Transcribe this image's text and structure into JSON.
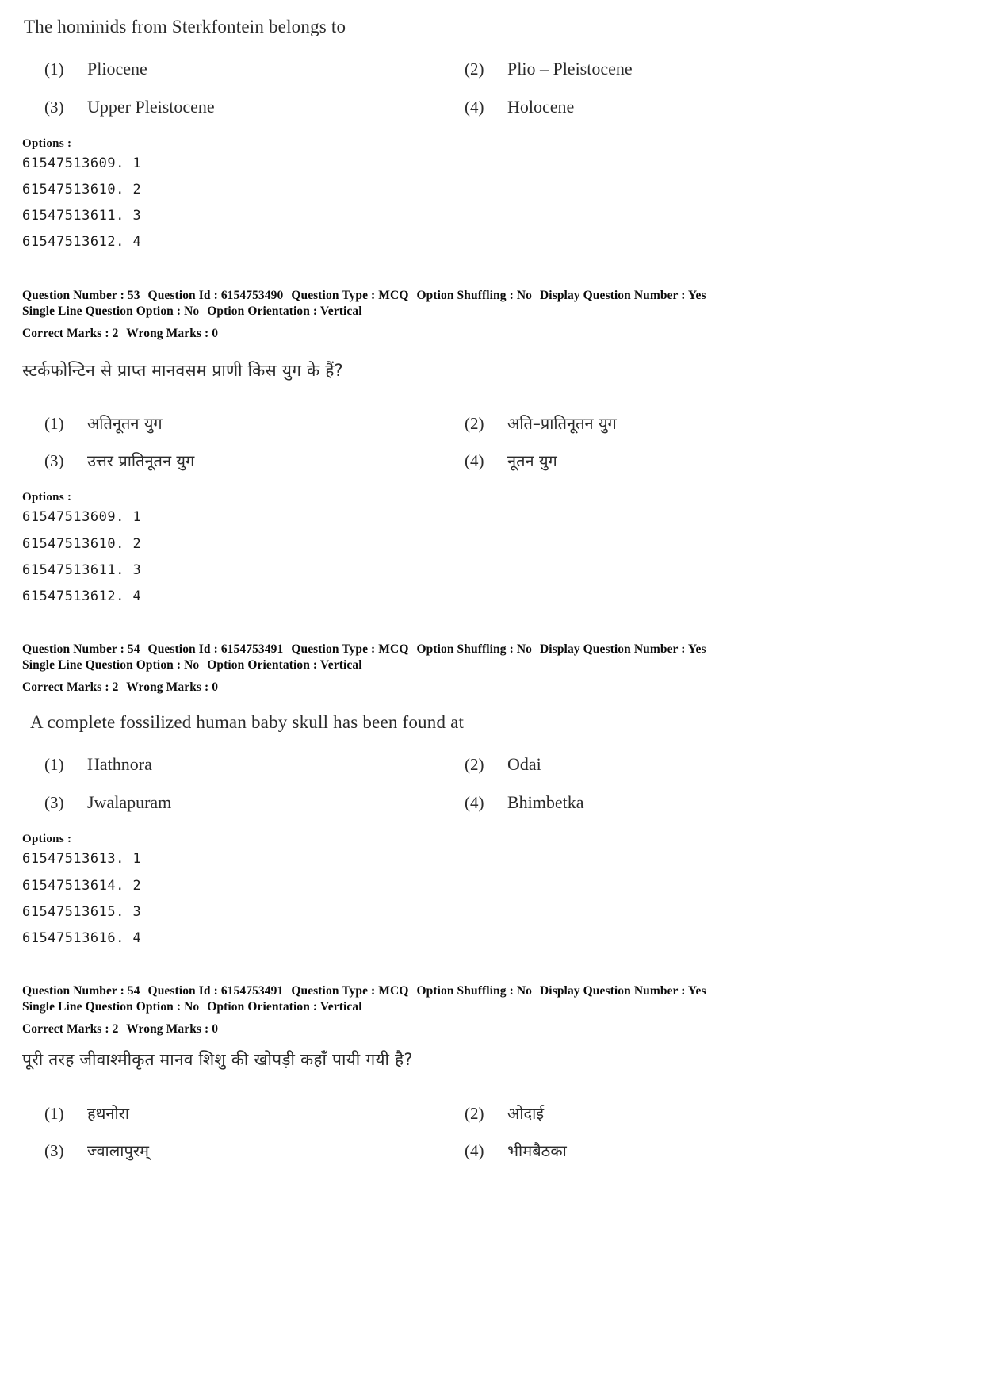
{
  "labels": {
    "options_heading": "Options :",
    "question_number": "Question Number :",
    "question_id": "Question Id :",
    "question_type": "Question Type :",
    "option_shuffling": "Option Shuffling :",
    "display_question_number": "Display Question Number :",
    "single_line_question_option": "Single Line Question Option :",
    "option_orientation": "Option Orientation :",
    "correct_marks": "Correct Marks :",
    "wrong_marks": "Wrong Marks :"
  },
  "blocks": [
    {
      "id": "q53-english",
      "stem": "The hominids from Sterkfontein belongs to",
      "choices": [
        {
          "num": "(1)",
          "text": "Pliocene"
        },
        {
          "num": "(2)",
          "text": "Plio – Pleistocene"
        },
        {
          "num": "(3)",
          "text": "Upper Pleistocene"
        },
        {
          "num": "(4)",
          "text": "Holocene"
        }
      ],
      "option_ids": [
        "61547513609. 1",
        "61547513610. 2",
        "61547513611. 3",
        "61547513612. 4"
      ],
      "meta": {
        "question_number": "53",
        "question_id": "6154753490",
        "question_type": "MCQ",
        "option_shuffling": "No",
        "display_question_number": "Yes",
        "single_line_question_option": "No",
        "option_orientation": "Vertical",
        "correct_marks": "2",
        "wrong_marks": "0"
      }
    },
    {
      "id": "q53-hindi",
      "stem": "स्टर्कफोन्टिन से प्राप्त मानवसम प्राणी किस युग के हैं?",
      "choices": [
        {
          "num": "(1)",
          "text": "अतिनूतन युग"
        },
        {
          "num": "(2)",
          "text": "अति–प्रातिनूतन युग"
        },
        {
          "num": "(3)",
          "text": "उत्तर प्रातिनूतन युग"
        },
        {
          "num": "(4)",
          "text": "नूतन युग"
        }
      ],
      "option_ids": [
        "61547513609. 1",
        "61547513610. 2",
        "61547513611. 3",
        "61547513612. 4"
      ],
      "meta": {
        "question_number": "54",
        "question_id": "6154753491",
        "question_type": "MCQ",
        "option_shuffling": "No",
        "display_question_number": "Yes",
        "single_line_question_option": "No",
        "option_orientation": "Vertical",
        "correct_marks": "2",
        "wrong_marks": "0"
      }
    },
    {
      "id": "q54-english",
      "stem": "A complete fossilized human baby skull has been found at",
      "choices": [
        {
          "num": "(1)",
          "text": "Hathnora"
        },
        {
          "num": "(2)",
          "text": "Odai"
        },
        {
          "num": "(3)",
          "text": "Jwalapuram"
        },
        {
          "num": "(4)",
          "text": "Bhimbetka"
        }
      ],
      "option_ids": [
        "61547513613. 1",
        "61547513614. 2",
        "61547513615. 3",
        "61547513616. 4"
      ],
      "meta": {
        "question_number": "54",
        "question_id": "6154753491",
        "question_type": "MCQ",
        "option_shuffling": "No",
        "display_question_number": "Yes",
        "single_line_question_option": "No",
        "option_orientation": "Vertical",
        "correct_marks": "2",
        "wrong_marks": "0"
      }
    },
    {
      "id": "q54-hindi",
      "stem": "पूरी तरह जीवाश्मीकृत मानव शिशु की खोपड़ी कहाँ पायी गयी है?",
      "choices": [
        {
          "num": "(1)",
          "text": "हथनोरा"
        },
        {
          "num": "(2)",
          "text": "ओदाई"
        },
        {
          "num": "(3)",
          "text": "ज्वालापुरम्"
        },
        {
          "num": "(4)",
          "text": "भीमबैठका"
        }
      ]
    }
  ]
}
